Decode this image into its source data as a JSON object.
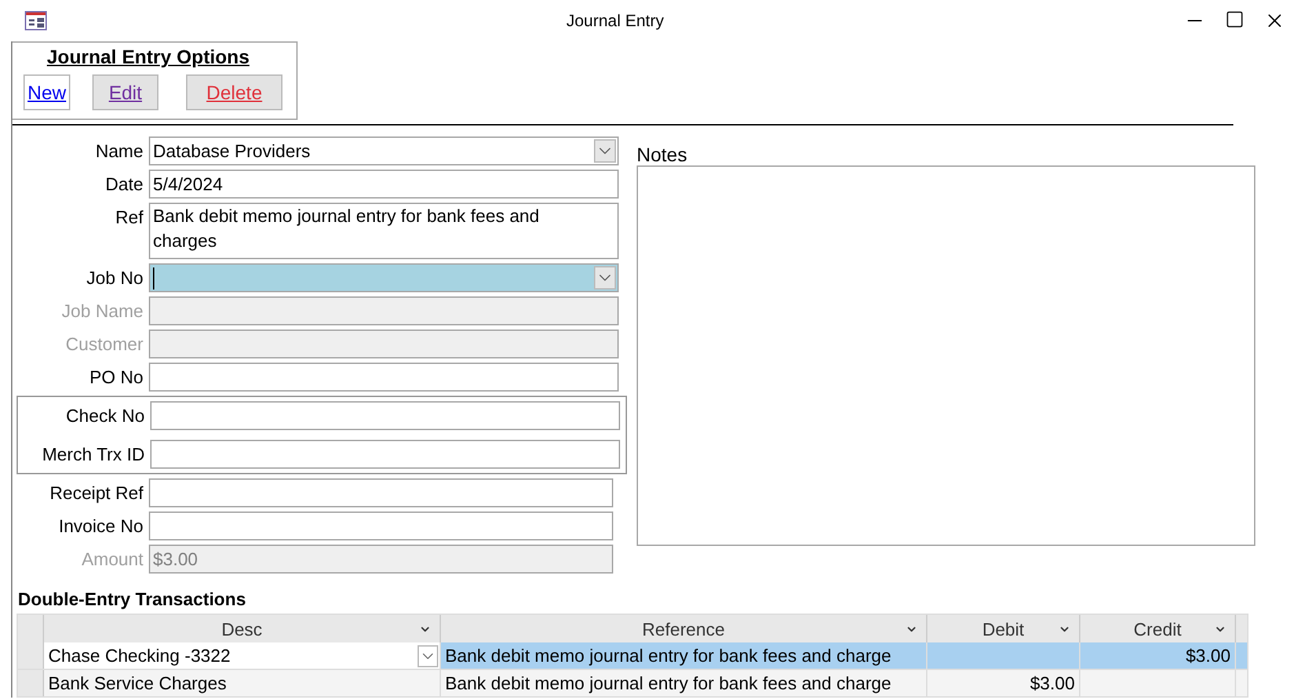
{
  "window": {
    "title": "Journal Entry"
  },
  "options": {
    "title": "Journal Entry  Options",
    "buttons": [
      {
        "label": "New",
        "kind": "new"
      },
      {
        "label": "Edit",
        "kind": "edit"
      },
      {
        "label": "Delete",
        "kind": "delete"
      }
    ]
  },
  "fields": [
    {
      "label": "Name",
      "value": "Database Providers",
      "kind": "combo",
      "disabled": false,
      "focused": false
    },
    {
      "label": "Date",
      "value": "5/4/2024",
      "kind": "text",
      "disabled": false,
      "focused": false
    },
    {
      "label": "Ref",
      "value": "Bank debit memo journal entry for bank fees and charges",
      "kind": "memo",
      "disabled": false,
      "focused": false
    },
    {
      "label": "Job No",
      "kind": "combo",
      "disabled": false,
      "focused": true
    },
    {
      "label": "Job Name",
      "kind": "text",
      "disabled": true,
      "focused": false
    },
    {
      "label": "Customer",
      "kind": "text",
      "disabled": true,
      "focused": false
    },
    {
      "label": "PO No",
      "kind": "text",
      "disabled": false,
      "focused": false
    }
  ],
  "payment_fields": [
    {
      "label": "Check No",
      "disabled": false,
      "focused": false
    },
    {
      "label": "Merch Trx ID",
      "disabled": false,
      "focused": false
    }
  ],
  "more_fields": [
    {
      "label": "Receipt Ref",
      "disabled": false,
      "focused": false
    },
    {
      "label": "Invoice No",
      "disabled": false,
      "focused": false
    },
    {
      "label": "Amount",
      "value": "$3.00",
      "disabled": true,
      "focused": false
    }
  ],
  "notes": {
    "label": "Notes"
  },
  "transactions": {
    "title": "Double-Entry Transactions",
    "columns": [
      {
        "label": "Desc"
      },
      {
        "label": "Reference"
      },
      {
        "label": "Debit"
      },
      {
        "label": "Credit"
      }
    ],
    "rows": [
      {
        "desc": "Chase Checking -3322",
        "reference": "Bank debit memo journal entry for bank fees and charge",
        "debit": "",
        "credit": "$3.00",
        "selected": true
      },
      {
        "desc": "Bank Service Charges",
        "reference": "Bank debit memo journal entry for bank fees and charge",
        "debit": "$3.00",
        "credit": "",
        "selected": false
      }
    ]
  }
}
